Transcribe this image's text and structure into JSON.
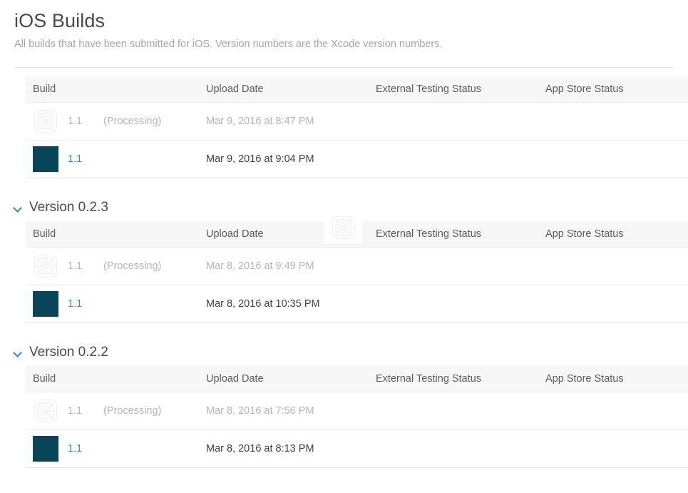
{
  "header": {
    "title": "iOS Builds",
    "subtitle": "All builds that have been submitted for iOS. Version numbers are the Xcode version numbers."
  },
  "colors": {
    "accent_link": "#2b8ccc",
    "chevron": "#1f8dd6",
    "app_icon": "#084559",
    "header_bg": "#f7f7f7",
    "muted_text": "#b5b5b5",
    "body_text": "#3f3f3f"
  },
  "columns": {
    "build": "Build",
    "upload_date": "Upload Date",
    "external_testing_status": "External Testing Status",
    "app_store_status": "App Store Status"
  },
  "groups": [
    {
      "heading": null,
      "chevron_icon": null,
      "rows": [
        {
          "icon": "app-icon-placeholder",
          "build": "1.1",
          "note": "(Processing)",
          "upload_date": "Mar 9, 2016 at 8:47 PM",
          "external_testing_status": "",
          "app_store_status": "",
          "processing": true,
          "build_is_link": false
        },
        {
          "icon": "app-icon-solid",
          "build": "1.1",
          "note": "",
          "upload_date": "Mar 9, 2016 at 9:04 PM",
          "external_testing_status": "",
          "app_store_status": "",
          "processing": false,
          "build_is_link": true
        }
      ]
    },
    {
      "heading": "Version 0.2.3",
      "chevron_icon": "chevron-down-icon",
      "rows": [
        {
          "icon": "app-icon-placeholder",
          "build": "1.1",
          "note": "(Processing)",
          "upload_date": "Mar 8, 2016 at 9:49 PM",
          "external_testing_status": "",
          "app_store_status": "",
          "processing": true,
          "build_is_link": false
        },
        {
          "icon": "app-icon-solid",
          "build": "1.1",
          "note": "",
          "upload_date": "Mar 8, 2016 at 10:35 PM",
          "external_testing_status": "",
          "app_store_status": "",
          "processing": false,
          "build_is_link": true
        }
      ]
    },
    {
      "heading": "Version 0.2.2",
      "chevron_icon": "chevron-down-icon",
      "rows": [
        {
          "icon": "app-icon-placeholder",
          "build": "1.1",
          "note": "(Processing)",
          "upload_date": "Mar 8, 2016 at 7:56 PM",
          "external_testing_status": "",
          "app_store_status": "",
          "processing": true,
          "build_is_link": false
        },
        {
          "icon": "app-icon-solid",
          "build": "1.1",
          "note": "",
          "upload_date": "Mar 8, 2016 at 8:13 PM",
          "external_testing_status": "",
          "app_store_status": "",
          "processing": false,
          "build_is_link": true
        }
      ]
    }
  ],
  "drag_ghost": {
    "icon": "app-icon-placeholder",
    "visible": true
  }
}
